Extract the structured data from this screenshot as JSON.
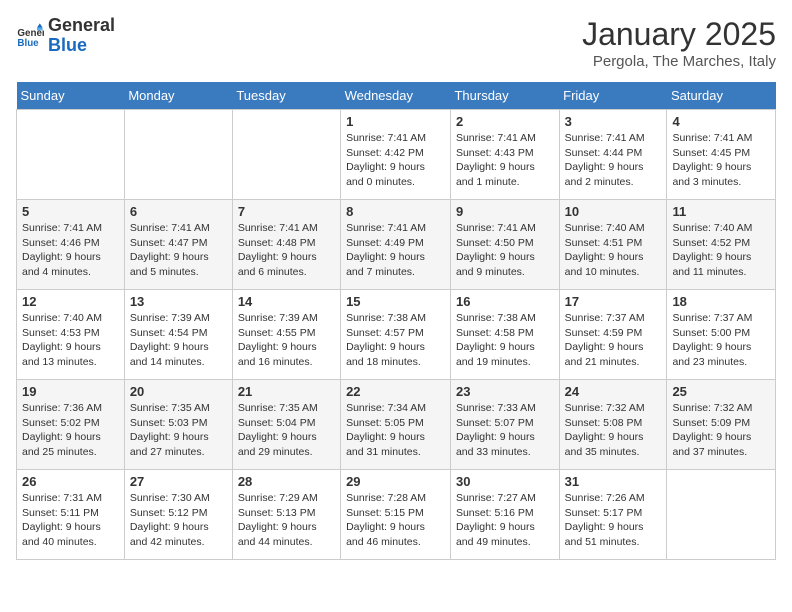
{
  "logo": {
    "line1": "General",
    "line2": "Blue"
  },
  "title": "January 2025",
  "location": "Pergola, The Marches, Italy",
  "days_header": [
    "Sunday",
    "Monday",
    "Tuesday",
    "Wednesday",
    "Thursday",
    "Friday",
    "Saturday"
  ],
  "weeks": [
    [
      {
        "day": "",
        "info": ""
      },
      {
        "day": "",
        "info": ""
      },
      {
        "day": "",
        "info": ""
      },
      {
        "day": "1",
        "info": "Sunrise: 7:41 AM\nSunset: 4:42 PM\nDaylight: 9 hours and 0 minutes."
      },
      {
        "day": "2",
        "info": "Sunrise: 7:41 AM\nSunset: 4:43 PM\nDaylight: 9 hours and 1 minute."
      },
      {
        "day": "3",
        "info": "Sunrise: 7:41 AM\nSunset: 4:44 PM\nDaylight: 9 hours and 2 minutes."
      },
      {
        "day": "4",
        "info": "Sunrise: 7:41 AM\nSunset: 4:45 PM\nDaylight: 9 hours and 3 minutes."
      }
    ],
    [
      {
        "day": "5",
        "info": "Sunrise: 7:41 AM\nSunset: 4:46 PM\nDaylight: 9 hours and 4 minutes."
      },
      {
        "day": "6",
        "info": "Sunrise: 7:41 AM\nSunset: 4:47 PM\nDaylight: 9 hours and 5 minutes."
      },
      {
        "day": "7",
        "info": "Sunrise: 7:41 AM\nSunset: 4:48 PM\nDaylight: 9 hours and 6 minutes."
      },
      {
        "day": "8",
        "info": "Sunrise: 7:41 AM\nSunset: 4:49 PM\nDaylight: 9 hours and 7 minutes."
      },
      {
        "day": "9",
        "info": "Sunrise: 7:41 AM\nSunset: 4:50 PM\nDaylight: 9 hours and 9 minutes."
      },
      {
        "day": "10",
        "info": "Sunrise: 7:40 AM\nSunset: 4:51 PM\nDaylight: 9 hours and 10 minutes."
      },
      {
        "day": "11",
        "info": "Sunrise: 7:40 AM\nSunset: 4:52 PM\nDaylight: 9 hours and 11 minutes."
      }
    ],
    [
      {
        "day": "12",
        "info": "Sunrise: 7:40 AM\nSunset: 4:53 PM\nDaylight: 9 hours and 13 minutes."
      },
      {
        "day": "13",
        "info": "Sunrise: 7:39 AM\nSunset: 4:54 PM\nDaylight: 9 hours and 14 minutes."
      },
      {
        "day": "14",
        "info": "Sunrise: 7:39 AM\nSunset: 4:55 PM\nDaylight: 9 hours and 16 minutes."
      },
      {
        "day": "15",
        "info": "Sunrise: 7:38 AM\nSunset: 4:57 PM\nDaylight: 9 hours and 18 minutes."
      },
      {
        "day": "16",
        "info": "Sunrise: 7:38 AM\nSunset: 4:58 PM\nDaylight: 9 hours and 19 minutes."
      },
      {
        "day": "17",
        "info": "Sunrise: 7:37 AM\nSunset: 4:59 PM\nDaylight: 9 hours and 21 minutes."
      },
      {
        "day": "18",
        "info": "Sunrise: 7:37 AM\nSunset: 5:00 PM\nDaylight: 9 hours and 23 minutes."
      }
    ],
    [
      {
        "day": "19",
        "info": "Sunrise: 7:36 AM\nSunset: 5:02 PM\nDaylight: 9 hours and 25 minutes."
      },
      {
        "day": "20",
        "info": "Sunrise: 7:35 AM\nSunset: 5:03 PM\nDaylight: 9 hours and 27 minutes."
      },
      {
        "day": "21",
        "info": "Sunrise: 7:35 AM\nSunset: 5:04 PM\nDaylight: 9 hours and 29 minutes."
      },
      {
        "day": "22",
        "info": "Sunrise: 7:34 AM\nSunset: 5:05 PM\nDaylight: 9 hours and 31 minutes."
      },
      {
        "day": "23",
        "info": "Sunrise: 7:33 AM\nSunset: 5:07 PM\nDaylight: 9 hours and 33 minutes."
      },
      {
        "day": "24",
        "info": "Sunrise: 7:32 AM\nSunset: 5:08 PM\nDaylight: 9 hours and 35 minutes."
      },
      {
        "day": "25",
        "info": "Sunrise: 7:32 AM\nSunset: 5:09 PM\nDaylight: 9 hours and 37 minutes."
      }
    ],
    [
      {
        "day": "26",
        "info": "Sunrise: 7:31 AM\nSunset: 5:11 PM\nDaylight: 9 hours and 40 minutes."
      },
      {
        "day": "27",
        "info": "Sunrise: 7:30 AM\nSunset: 5:12 PM\nDaylight: 9 hours and 42 minutes."
      },
      {
        "day": "28",
        "info": "Sunrise: 7:29 AM\nSunset: 5:13 PM\nDaylight: 9 hours and 44 minutes."
      },
      {
        "day": "29",
        "info": "Sunrise: 7:28 AM\nSunset: 5:15 PM\nDaylight: 9 hours and 46 minutes."
      },
      {
        "day": "30",
        "info": "Sunrise: 7:27 AM\nSunset: 5:16 PM\nDaylight: 9 hours and 49 minutes."
      },
      {
        "day": "31",
        "info": "Sunrise: 7:26 AM\nSunset: 5:17 PM\nDaylight: 9 hours and 51 minutes."
      },
      {
        "day": "",
        "info": ""
      }
    ]
  ]
}
